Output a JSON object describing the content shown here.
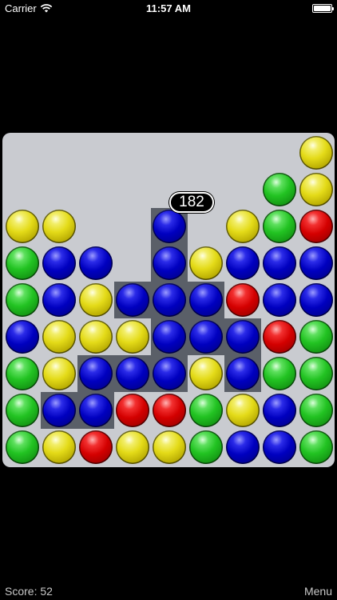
{
  "status_bar": {
    "carrier": "Carrier",
    "time": "11:57 AM"
  },
  "board": {
    "columns": 9,
    "rows": 9,
    "colors": {
      "Y": "#e4db18",
      "G": "#22c322",
      "B": "#0000c0",
      "R": "#d40000",
      "board_background": "#c9cbd0",
      "selection_highlight": "#5a5f68"
    },
    "grid": [
      [
        "",
        "",
        "",
        "",
        "",
        "",
        "",
        "",
        "Y"
      ],
      [
        "",
        "",
        "",
        "",
        "",
        "",
        "",
        "G",
        "Y"
      ],
      [
        "Y",
        "Y",
        "",
        "",
        "B",
        "",
        "Y",
        "G",
        "R"
      ],
      [
        "G",
        "B",
        "B",
        "",
        "B",
        "Y",
        "B",
        "B",
        "B"
      ],
      [
        "G",
        "B",
        "Y",
        "B",
        "B",
        "B",
        "R",
        "B",
        "B"
      ],
      [
        "B",
        "Y",
        "Y",
        "Y",
        "B",
        "B",
        "B",
        "R",
        "G"
      ],
      [
        "G",
        "Y",
        "B",
        "B",
        "B",
        "Y",
        "B",
        "G",
        "G"
      ],
      [
        "G",
        "B",
        "B",
        "R",
        "R",
        "G",
        "Y",
        "B",
        "G"
      ],
      [
        "G",
        "Y",
        "R",
        "Y",
        "Y",
        "G",
        "B",
        "B",
        "G"
      ]
    ],
    "selected_group": [
      [
        2,
        4
      ],
      [
        3,
        4
      ],
      [
        4,
        3
      ],
      [
        4,
        4
      ],
      [
        4,
        5
      ],
      [
        5,
        4
      ],
      [
        5,
        5
      ],
      [
        5,
        6
      ],
      [
        6,
        2
      ],
      [
        6,
        3
      ],
      [
        6,
        4
      ],
      [
        6,
        6
      ],
      [
        7,
        1
      ],
      [
        7,
        2
      ]
    ],
    "selection_points": "182"
  },
  "footer": {
    "score": "Score: 52",
    "menu": "Menu"
  }
}
